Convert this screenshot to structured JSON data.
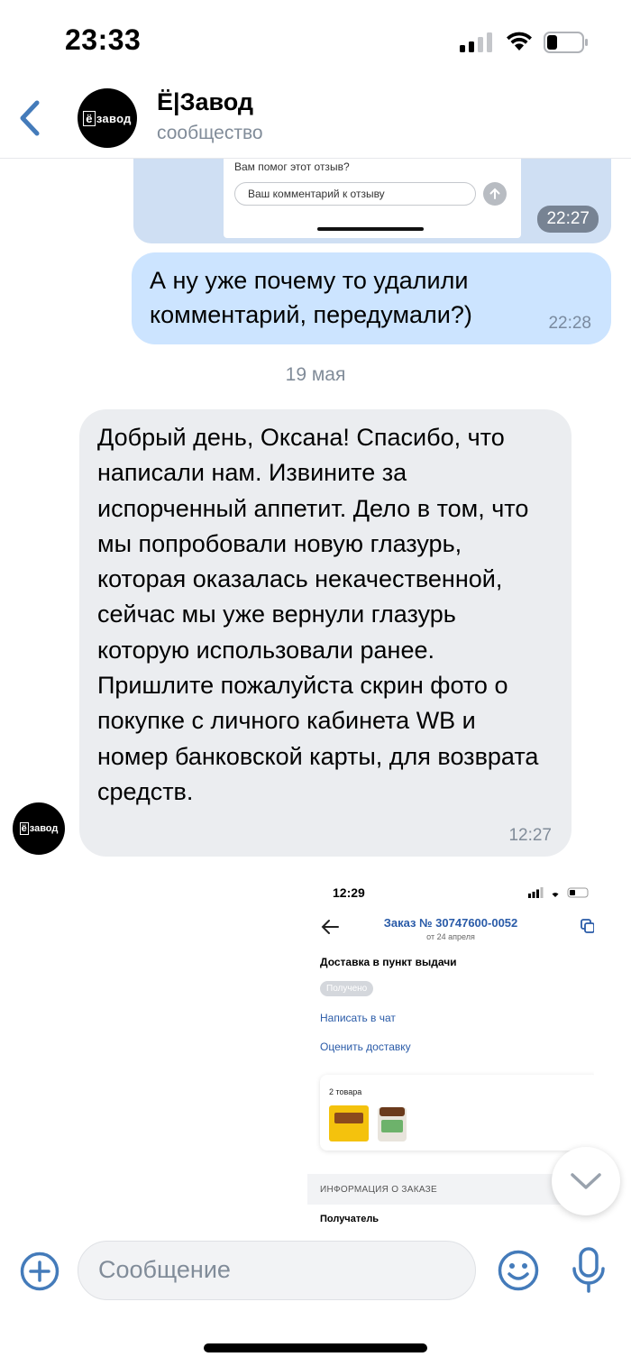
{
  "status_bar": {
    "time": "23:33"
  },
  "header": {
    "title": "Ё|Завод",
    "subtitle": "сообщество",
    "avatar_text": {
      "box": "ё",
      "rest": "завод"
    }
  },
  "messages": {
    "top_image": {
      "question": "Вам помог этот отзыв?",
      "input_placeholder": "Ваш комментарий к отзыву",
      "time": "22:27"
    },
    "outgoing": {
      "text": "А ну уже почему то удалили комментарий, передумали?)",
      "time": "22:28"
    },
    "date_separator": "19 мая",
    "incoming": {
      "text": "Добрый день, Оксана! Спасибо, что написали нам. Извините за испорченный аппетит. Дело в том, что мы попробовали новую глазурь, которая оказалась некачественной, сейчас мы уже вернули глазурь которую использовали ранее.\nПришлите пожалуйста скрин фото о покупке с личного кабинета WB и номер банковской карты, для возврата средств.",
      "time": "12:27",
      "sender_avatar_text": {
        "box": "ё",
        "rest": "завод"
      }
    },
    "order_screenshot": {
      "time": "12:29",
      "title": "Заказ № 30747600-0052",
      "subtitle": "от 24 апреля",
      "delivery": "Доставка в пункт выдачи",
      "badge": "Получено",
      "link_chat": "Написать в чат",
      "link_rate": "Оценить доставку",
      "items_label": "2 товара",
      "info_header": "ИНФОРМАЦИЯ О ЗАКАЗЕ",
      "recipient": "Получатель"
    }
  },
  "input": {
    "placeholder": "Сообщение"
  },
  "colors": {
    "accent": "#447bba",
    "outgoing_bubble": "#cce4ff",
    "incoming_bubble": "#ebedf0",
    "secondary_text": "#818c99"
  }
}
